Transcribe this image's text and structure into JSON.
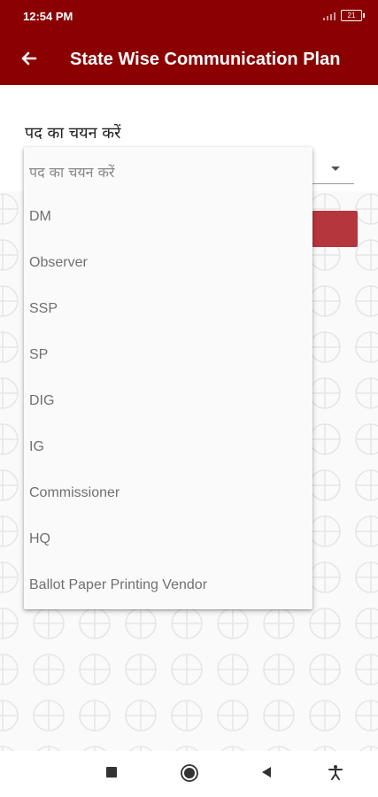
{
  "status": {
    "time": "12:54 PM",
    "battery": "21"
  },
  "app_bar": {
    "title": "State Wise Communication Plan",
    "back_icon": "arrow-left-icon"
  },
  "form": {
    "label": "पद का चयन करें"
  },
  "dropdown": {
    "header": "पद का चयन करें",
    "selected": "DM",
    "options": [
      "DM",
      "Observer",
      "SSP",
      "SP",
      "DIG",
      "IG",
      "Commissioner",
      "HQ",
      "Ballot Paper Printing Vendor"
    ]
  },
  "colors": {
    "app_bar": "#8b0000",
    "accent": "#b5363c",
    "selection_indicator": "#2aa040"
  },
  "nav": {
    "icons": [
      "square-icon",
      "home-circle-icon",
      "back-triangle-icon",
      "accessibility-icon"
    ]
  }
}
